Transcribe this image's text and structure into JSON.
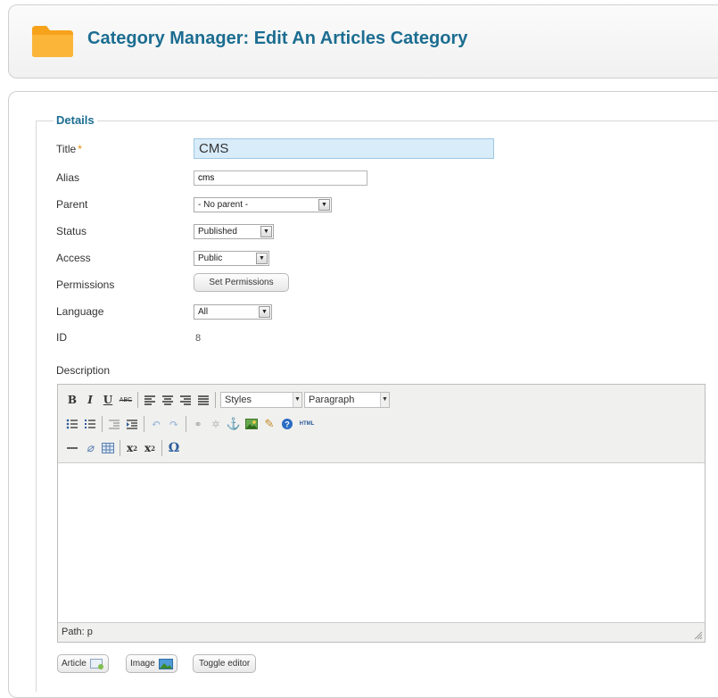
{
  "header": {
    "title": "Category Manager: Edit An Articles Category",
    "folder_icon": "folder-icon",
    "title_color": "#1c6d91",
    "folder_color": "#f7a21b"
  },
  "form": {
    "legend": "Details",
    "required_mark": "*",
    "fields": {
      "title_label": "Title",
      "title_value": "CMS",
      "alias_label": "Alias",
      "alias_value": "cms",
      "parent_label": "Parent",
      "parent_value": "- No parent -",
      "status_label": "Status",
      "status_value": "Published",
      "access_label": "Access",
      "access_value": "Public",
      "permissions_label": "Permissions",
      "permissions_button": "Set Permissions",
      "language_label": "Language",
      "language_value": "All",
      "id_label": "ID",
      "id_value": "8",
      "description_label": "Description"
    }
  },
  "editor": {
    "styles_select": "Styles",
    "format_select": "Paragraph",
    "html_label": "HTML",
    "status_path": "Path: p",
    "row1_icons": [
      "bold-icon",
      "italic-icon",
      "underline-icon",
      "strikethrough-icon",
      "align-left-icon",
      "align-center-icon",
      "align-right-icon",
      "align-justify-icon"
    ],
    "row2_icons": [
      "bullet-list-icon",
      "numbered-list-icon",
      "outdent-icon",
      "indent-icon",
      "undo-icon",
      "redo-icon",
      "link-icon",
      "unlink-icon",
      "anchor-icon",
      "image-icon",
      "cleanup-icon",
      "help-icon",
      "html-icon"
    ],
    "row3_icons": [
      "horizontal-rule-icon",
      "remove-format-icon",
      "table-icon",
      "subscript-icon",
      "superscript-icon",
      "special-char-icon"
    ]
  },
  "buttons": {
    "article": "Article",
    "image": "Image",
    "toggle_editor": "Toggle editor"
  }
}
